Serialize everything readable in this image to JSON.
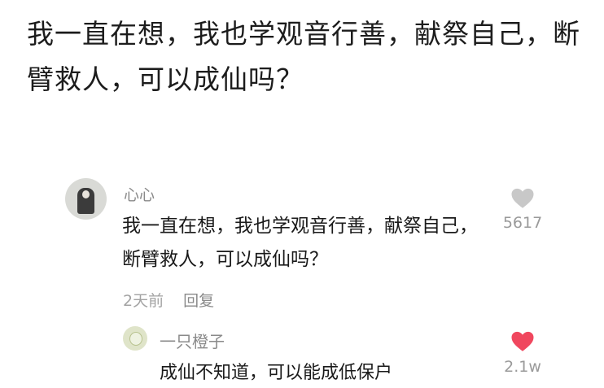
{
  "post": {
    "headline": "我一直在想，我也学观音行善，献祭自己，断臂救人，可以成仙吗？"
  },
  "comment": {
    "username": "心心",
    "text": "我一直在想，我也学观音行善，献祭自己，断臂救人，可以成仙吗？",
    "time": "2天前",
    "reply_label": "回复",
    "like_count": "5617",
    "like_icon": "heart-outline-icon",
    "like_color": "#c8c8c8"
  },
  "reply": {
    "username": "一只橙子",
    "text": "成仙不知道，可以能成低保户",
    "like_count": "2.1w",
    "like_icon": "heart-filled-icon",
    "like_color": "#f0475e"
  }
}
